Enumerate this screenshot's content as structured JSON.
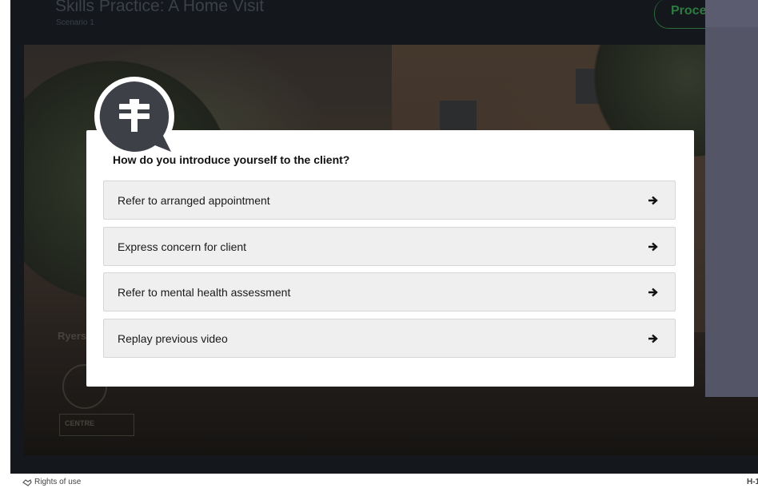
{
  "header": {
    "title": "Skills Practice: A Home Visit",
    "subtitle": "Scenario 1",
    "proceed_label": "Proceed"
  },
  "video": {
    "logo_text": "Ryerson University",
    "logo_box_text": "CENTRE"
  },
  "dialog": {
    "question": "How do you introduce yourself to the client?",
    "options": [
      {
        "label": "Refer to arranged appointment"
      },
      {
        "label": "Express concern for client"
      },
      {
        "label": "Refer to mental health assessment"
      },
      {
        "label": "Replay previous video"
      }
    ]
  },
  "footer": {
    "rights_label": "Rights of use",
    "right_text": "H-1"
  },
  "colors": {
    "stage_bg": "#14171c",
    "side_panel": "#555568",
    "option_bg": "#efefef",
    "bubble": "#3e4048"
  }
}
